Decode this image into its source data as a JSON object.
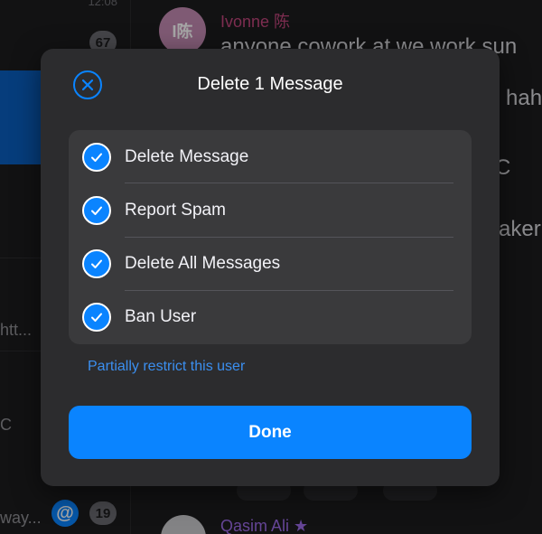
{
  "background": {
    "sidebar": {
      "time": "12:08",
      "badge_top": "67",
      "snippet_1": "htt...",
      "snippet_2": "C",
      "snippet_3": "way...",
      "badge_bottom": "19",
      "mention_symbol": "@"
    },
    "chat": {
      "avatar_initials": "I陈",
      "sender_name": "Ivonne 陈",
      "message_line_1": "anyone cowork at we work sun",
      "message_line_2": "hah",
      "message_line_3": "C",
      "message_line_4": "aker",
      "sender_2_name": "Qasim Ali",
      "sender_2_star": "★"
    }
  },
  "dialog": {
    "title": "Delete 1 Message",
    "options": [
      {
        "label": "Delete Message",
        "checked": true
      },
      {
        "label": "Report Spam",
        "checked": true
      },
      {
        "label": "Delete All Messages",
        "checked": true
      },
      {
        "label": "Ban User",
        "checked": true
      }
    ],
    "restrict_link": "Partially restrict this user",
    "done_label": "Done"
  },
  "colors": {
    "accent": "#0a84ff",
    "modal_bg": "#2c2c2e",
    "option_group_bg": "#3a3a3c",
    "link": "#3b8ff0"
  },
  "icons": {
    "close": "close-circle-icon",
    "check": "checkmark-circle-icon"
  }
}
